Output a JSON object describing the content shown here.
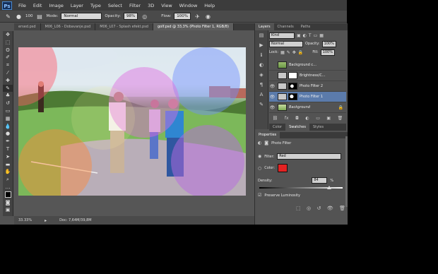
{
  "app": {
    "logo": "Ps"
  },
  "menu": [
    "File",
    "Edit",
    "Image",
    "Layer",
    "Type",
    "Select",
    "Filter",
    "3D",
    "View",
    "Window",
    "Help"
  ],
  "options": {
    "size": "100",
    "mode_label": "Mode:",
    "mode_value": "Normal",
    "opacity_label": "Opacity:",
    "opacity_value": "98%",
    "flow_label": "Flow:",
    "flow_value": "100%"
  },
  "doc_tabs": [
    "ersed.psd",
    "M06_L06 - Dobavanje.psd",
    "M06_L07 - Splash efekt.psd",
    "golf.psd @ 33,3% (Photo Filter 1, RGB/8)"
  ],
  "status": {
    "zoom": "33.33%",
    "doc": "Doc: 7,64M/39,8M"
  },
  "panel_tabs": [
    "Layers",
    "Channels",
    "Paths"
  ],
  "layers_panel": {
    "kind_label": "Kind",
    "blend_mode": "Normal",
    "opacity_label": "Opacity:",
    "opacity_value": "100%",
    "lock_label": "Lock:",
    "fill_label": "Fill:",
    "fill_value": "100%",
    "layers": [
      {
        "name": "Background c..."
      },
      {
        "name": "Brightness/C..."
      },
      {
        "name": "Photo Filter 2"
      },
      {
        "name": "Photo Filter 1"
      },
      {
        "name": "Background"
      }
    ]
  },
  "sub_tabs": [
    "Color",
    "Swatches",
    "Styles"
  ],
  "properties": {
    "header": "Properties",
    "title": "Photo Filter",
    "filter_label": "Filter:",
    "filter_value": "Red",
    "color_label": "Color:",
    "color_value": "#e32222",
    "density_label": "Density:",
    "density_value": "84",
    "density_unit": "%",
    "preserve_label": "Preserve Luminosity"
  },
  "colors": {
    "accent": "#5b7bab",
    "swatch": "#e32222"
  }
}
